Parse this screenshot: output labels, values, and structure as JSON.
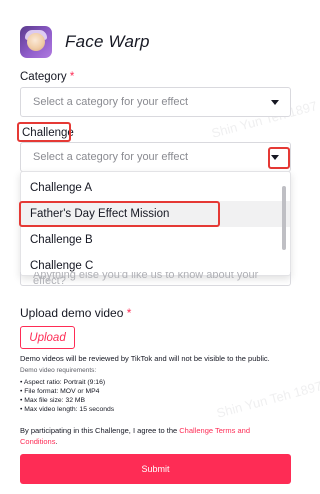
{
  "header": {
    "app_title": "Face Warp",
    "icon": "face-warp-app-icon"
  },
  "category": {
    "label": "Category",
    "required_mark": "*",
    "placeholder": "Select a category for your effect"
  },
  "challenge": {
    "label": "Challenge",
    "placeholder": "Select a category for your effect",
    "options": [
      "Challenge A",
      "Father's Day Effect Mission",
      "Challenge B",
      "Challenge C"
    ],
    "hovered_option": "Father's Day Effect Mission"
  },
  "description": {
    "placeholder": "Anything else you'd like us to know about your effect?"
  },
  "upload": {
    "label": "Upload demo video",
    "required_mark": "*",
    "button_label": "Upload",
    "review_note": "Demo videos will be reviewed by TikTok and will not be visible to the public.",
    "requirements_title": "Demo video requirements:",
    "requirements": [
      "• Aspect ratio: Portrait (9:16)",
      "• File format: MOV or MP4",
      "• Max file size: 32 MB",
      "• Max video length: 15 seconds"
    ]
  },
  "terms": {
    "prefix": "By participating in this Challenge, I agree to the ",
    "link": "Challenge Terms and Conditions",
    "suffix": "."
  },
  "submit_label": "Submit",
  "watermark": "Shin Yun Teh 1897",
  "colors": {
    "accent": "#fe2c55",
    "highlight_box": "#e53935"
  }
}
